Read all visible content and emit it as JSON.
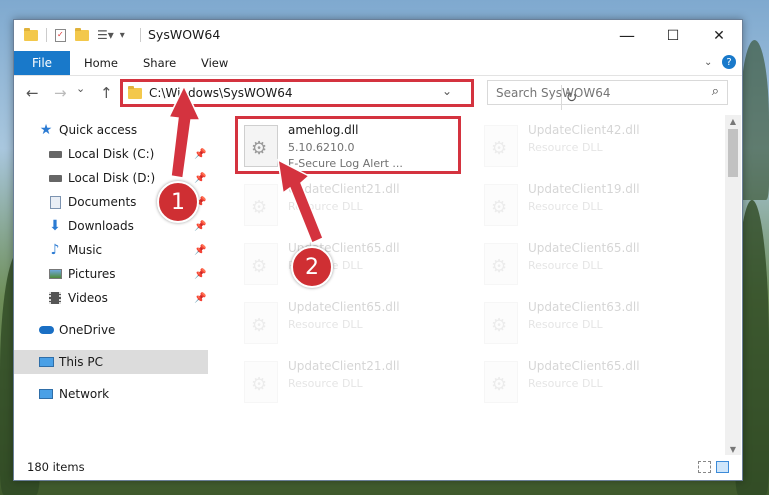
{
  "window": {
    "title": "SysWOW64",
    "controls": {
      "minimize": "—",
      "maximize": "☐",
      "close": "✕"
    }
  },
  "ribbon": {
    "tabs": [
      {
        "label": "File",
        "active": true
      },
      {
        "label": "Home"
      },
      {
        "label": "Share"
      },
      {
        "label": "View"
      }
    ],
    "help": "?"
  },
  "nav": {
    "back": "←",
    "forward": "→",
    "recent": "⌄",
    "up": "↑",
    "address": "C:\\Windows\\SysWOW64",
    "refresh": "↻",
    "search_placeholder": "Search SysWOW64"
  },
  "sidebar": {
    "items": [
      {
        "label": "Quick access",
        "icon": "star-icon"
      },
      {
        "label": "Local Disk (C:)",
        "icon": "drive-icon",
        "pinned": true
      },
      {
        "label": "Local Disk (D:)",
        "icon": "drive-icon",
        "pinned": true
      },
      {
        "label": "Documents",
        "icon": "documents-icon",
        "pinned": true
      },
      {
        "label": "Downloads",
        "icon": "download-icon",
        "pinned": true
      },
      {
        "label": "Music",
        "icon": "music-icon",
        "pinned": true
      },
      {
        "label": "Pictures",
        "icon": "pictures-icon",
        "pinned": true
      },
      {
        "label": "Videos",
        "icon": "videos-icon",
        "pinned": true
      },
      {
        "label": "OneDrive",
        "icon": "cloud-icon"
      },
      {
        "label": "This PC",
        "icon": "computer-icon",
        "selected": true
      },
      {
        "label": "Network",
        "icon": "network-icon"
      }
    ]
  },
  "files": [
    {
      "name": "amehlog.dll",
      "version": "5.10.6210.0",
      "description": "F-Secure Log Alert ...",
      "highlighted": true
    },
    {
      "name": "UpdateClient42.dll",
      "description": "Resource DLL"
    },
    {
      "name": "UpdateClient21.dll",
      "description": "Resource DLL"
    },
    {
      "name": "UpdateClient19.dll",
      "description": "Resource DLL"
    },
    {
      "name": "UpdateClient65.dll",
      "description": "Resource DLL"
    },
    {
      "name": "UpdateClient65.dll",
      "description": "Resource DLL"
    },
    {
      "name": "UpdateClient65.dll",
      "description": "Resource DLL"
    },
    {
      "name": "UpdateClient63.dll",
      "description": "Resource DLL"
    },
    {
      "name": "UpdateClient21.dll",
      "description": "Resource DLL"
    },
    {
      "name": "UpdateClient65.dll",
      "description": "Resource DLL"
    }
  ],
  "status": {
    "item_count": "180 items"
  },
  "annotations": {
    "step1": "1",
    "step2": "2",
    "highlight_color": "#d4333f"
  },
  "colors": {
    "accent": "#1979ca",
    "folder": "#f3c84b",
    "badge": "#cf2f33"
  }
}
